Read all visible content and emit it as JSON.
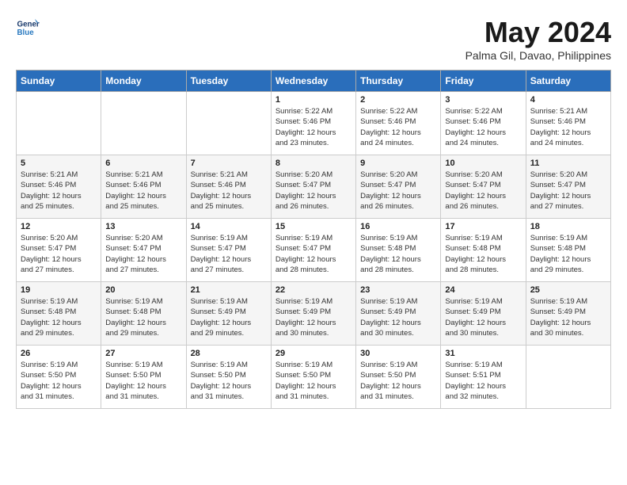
{
  "header": {
    "logo_line1": "General",
    "logo_line2": "Blue",
    "month": "May 2024",
    "location": "Palma Gil, Davao, Philippines"
  },
  "weekdays": [
    "Sunday",
    "Monday",
    "Tuesday",
    "Wednesday",
    "Thursday",
    "Friday",
    "Saturday"
  ],
  "weeks": [
    [
      {
        "day": "",
        "info": ""
      },
      {
        "day": "",
        "info": ""
      },
      {
        "day": "",
        "info": ""
      },
      {
        "day": "1",
        "info": "Sunrise: 5:22 AM\nSunset: 5:46 PM\nDaylight: 12 hours\nand 23 minutes."
      },
      {
        "day": "2",
        "info": "Sunrise: 5:22 AM\nSunset: 5:46 PM\nDaylight: 12 hours\nand 24 minutes."
      },
      {
        "day": "3",
        "info": "Sunrise: 5:22 AM\nSunset: 5:46 PM\nDaylight: 12 hours\nand 24 minutes."
      },
      {
        "day": "4",
        "info": "Sunrise: 5:21 AM\nSunset: 5:46 PM\nDaylight: 12 hours\nand 24 minutes."
      }
    ],
    [
      {
        "day": "5",
        "info": "Sunrise: 5:21 AM\nSunset: 5:46 PM\nDaylight: 12 hours\nand 25 minutes."
      },
      {
        "day": "6",
        "info": "Sunrise: 5:21 AM\nSunset: 5:46 PM\nDaylight: 12 hours\nand 25 minutes."
      },
      {
        "day": "7",
        "info": "Sunrise: 5:21 AM\nSunset: 5:46 PM\nDaylight: 12 hours\nand 25 minutes."
      },
      {
        "day": "8",
        "info": "Sunrise: 5:20 AM\nSunset: 5:47 PM\nDaylight: 12 hours\nand 26 minutes."
      },
      {
        "day": "9",
        "info": "Sunrise: 5:20 AM\nSunset: 5:47 PM\nDaylight: 12 hours\nand 26 minutes."
      },
      {
        "day": "10",
        "info": "Sunrise: 5:20 AM\nSunset: 5:47 PM\nDaylight: 12 hours\nand 26 minutes."
      },
      {
        "day": "11",
        "info": "Sunrise: 5:20 AM\nSunset: 5:47 PM\nDaylight: 12 hours\nand 27 minutes."
      }
    ],
    [
      {
        "day": "12",
        "info": "Sunrise: 5:20 AM\nSunset: 5:47 PM\nDaylight: 12 hours\nand 27 minutes."
      },
      {
        "day": "13",
        "info": "Sunrise: 5:20 AM\nSunset: 5:47 PM\nDaylight: 12 hours\nand 27 minutes."
      },
      {
        "day": "14",
        "info": "Sunrise: 5:19 AM\nSunset: 5:47 PM\nDaylight: 12 hours\nand 27 minutes."
      },
      {
        "day": "15",
        "info": "Sunrise: 5:19 AM\nSunset: 5:47 PM\nDaylight: 12 hours\nand 28 minutes."
      },
      {
        "day": "16",
        "info": "Sunrise: 5:19 AM\nSunset: 5:48 PM\nDaylight: 12 hours\nand 28 minutes."
      },
      {
        "day": "17",
        "info": "Sunrise: 5:19 AM\nSunset: 5:48 PM\nDaylight: 12 hours\nand 28 minutes."
      },
      {
        "day": "18",
        "info": "Sunrise: 5:19 AM\nSunset: 5:48 PM\nDaylight: 12 hours\nand 29 minutes."
      }
    ],
    [
      {
        "day": "19",
        "info": "Sunrise: 5:19 AM\nSunset: 5:48 PM\nDaylight: 12 hours\nand 29 minutes."
      },
      {
        "day": "20",
        "info": "Sunrise: 5:19 AM\nSunset: 5:48 PM\nDaylight: 12 hours\nand 29 minutes."
      },
      {
        "day": "21",
        "info": "Sunrise: 5:19 AM\nSunset: 5:49 PM\nDaylight: 12 hours\nand 29 minutes."
      },
      {
        "day": "22",
        "info": "Sunrise: 5:19 AM\nSunset: 5:49 PM\nDaylight: 12 hours\nand 30 minutes."
      },
      {
        "day": "23",
        "info": "Sunrise: 5:19 AM\nSunset: 5:49 PM\nDaylight: 12 hours\nand 30 minutes."
      },
      {
        "day": "24",
        "info": "Sunrise: 5:19 AM\nSunset: 5:49 PM\nDaylight: 12 hours\nand 30 minutes."
      },
      {
        "day": "25",
        "info": "Sunrise: 5:19 AM\nSunset: 5:49 PM\nDaylight: 12 hours\nand 30 minutes."
      }
    ],
    [
      {
        "day": "26",
        "info": "Sunrise: 5:19 AM\nSunset: 5:50 PM\nDaylight: 12 hours\nand 31 minutes."
      },
      {
        "day": "27",
        "info": "Sunrise: 5:19 AM\nSunset: 5:50 PM\nDaylight: 12 hours\nand 31 minutes."
      },
      {
        "day": "28",
        "info": "Sunrise: 5:19 AM\nSunset: 5:50 PM\nDaylight: 12 hours\nand 31 minutes."
      },
      {
        "day": "29",
        "info": "Sunrise: 5:19 AM\nSunset: 5:50 PM\nDaylight: 12 hours\nand 31 minutes."
      },
      {
        "day": "30",
        "info": "Sunrise: 5:19 AM\nSunset: 5:50 PM\nDaylight: 12 hours\nand 31 minutes."
      },
      {
        "day": "31",
        "info": "Sunrise: 5:19 AM\nSunset: 5:51 PM\nDaylight: 12 hours\nand 32 minutes."
      },
      {
        "day": "",
        "info": ""
      }
    ]
  ]
}
